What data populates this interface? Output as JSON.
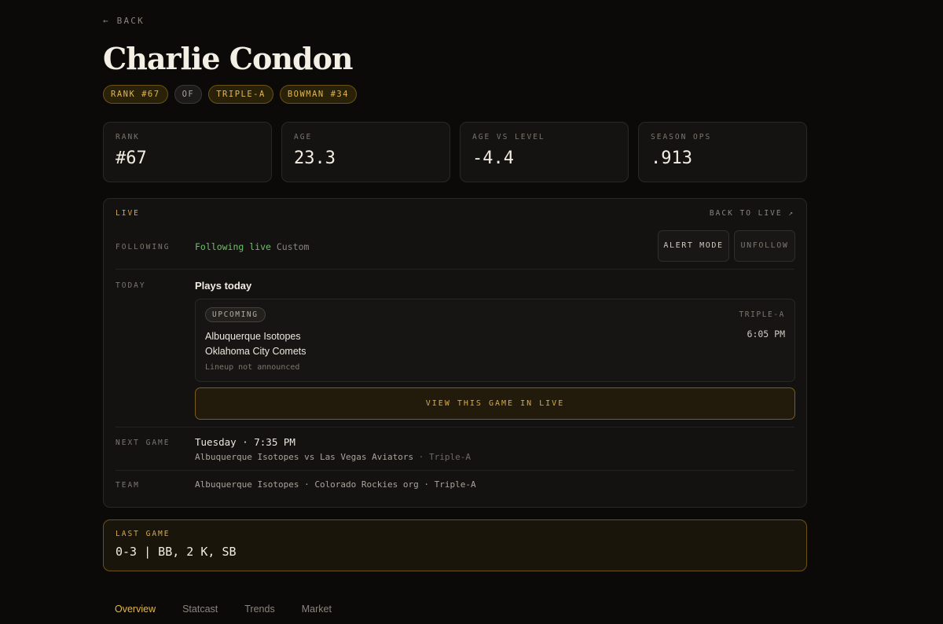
{
  "nav": {
    "back_label": "← BACK"
  },
  "player": {
    "name": "Charlie Condon",
    "badges": [
      "RANK #67",
      "OF",
      "TRIPLE-A",
      "BOWMAN #34"
    ]
  },
  "stats": [
    {
      "label": "RANK",
      "value": "#67"
    },
    {
      "label": "AGE",
      "value": "23.3"
    },
    {
      "label": "AGE VS LEVEL",
      "value": "-4.4"
    },
    {
      "label": "SEASON OPS",
      "value": ".913"
    }
  ],
  "live": {
    "tag": "LIVE",
    "back_to_live": "BACK TO LIVE ↗",
    "following_label": "FOLLOWING",
    "following_status": "Following live",
    "following_mode": "Custom",
    "alert_button": "ALERT MODE",
    "unfollow_button": "UNFOLLOW",
    "today_label": "TODAY",
    "plays_today": "Plays today",
    "game": {
      "status": "UPCOMING",
      "level": "TRIPLE-A",
      "time": "6:05 PM",
      "team1": "Albuquerque Isotopes",
      "team2": "Oklahoma City Comets",
      "lineup": "Lineup not announced"
    },
    "view_button": "VIEW THIS GAME IN LIVE",
    "next_label": "NEXT GAME",
    "next_time": "Tuesday · 7:35 PM",
    "next_match": "Albuquerque Isotopes vs Las Vegas Aviators",
    "next_level": " · Triple-A",
    "team_label": "TEAM",
    "team_value": "Albuquerque Isotopes · Colorado Rockies org · Triple-A"
  },
  "last_game": {
    "label": "LAST GAME",
    "value": "0-3 | BB, 2 K, SB"
  },
  "tabs": [
    "Overview",
    "Statcast",
    "Trends",
    "Market"
  ],
  "colors": {
    "accent": "#d9a846",
    "live_green": "#6fbf6a",
    "background": "#0b0a09"
  }
}
